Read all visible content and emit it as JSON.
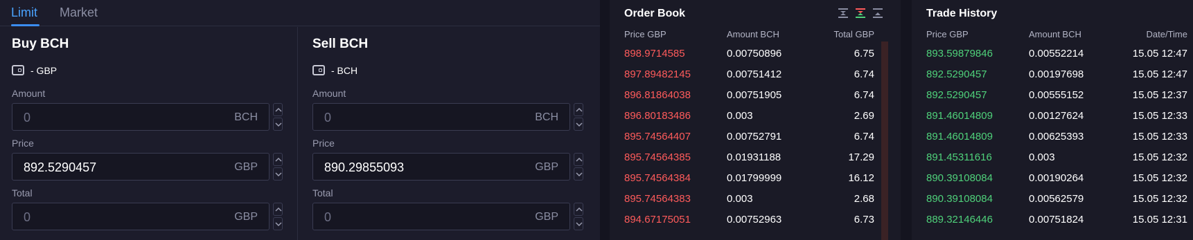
{
  "tabs": [
    {
      "label": "Limit",
      "active": true
    },
    {
      "label": "Market",
      "active": false
    }
  ],
  "buy": {
    "title": "Buy BCH",
    "wallet": "- GBP",
    "amount": {
      "label": "Amount",
      "placeholder": "0",
      "unit": "BCH"
    },
    "price": {
      "label": "Price",
      "value": "892.5290457",
      "unit": "GBP"
    },
    "total": {
      "label": "Total",
      "placeholder": "0",
      "unit": "GBP"
    }
  },
  "sell": {
    "title": "Sell BCH",
    "wallet": "- BCH",
    "amount": {
      "label": "Amount",
      "placeholder": "0",
      "unit": "BCH"
    },
    "price": {
      "label": "Price",
      "value": "890.29855093",
      "unit": "GBP"
    },
    "total": {
      "label": "Total",
      "placeholder": "0",
      "unit": "GBP"
    }
  },
  "order_book": {
    "title": "Order Book",
    "headers": [
      "Price GBP",
      "Amount BCH",
      "Total GBP"
    ],
    "asks": [
      [
        "898.9714585",
        "0.00750896",
        "6.75"
      ],
      [
        "897.89482145",
        "0.00751412",
        "6.74"
      ],
      [
        "896.81864038",
        "0.00751905",
        "6.74"
      ],
      [
        "896.80183486",
        "0.003",
        "2.69"
      ],
      [
        "895.74564407",
        "0.00752791",
        "6.74"
      ],
      [
        "895.74564385",
        "0.01931188",
        "17.29"
      ],
      [
        "895.74564384",
        "0.01799999",
        "16.12"
      ],
      [
        "895.74564383",
        "0.003",
        "2.68"
      ],
      [
        "894.67175051",
        "0.00752963",
        "6.73"
      ]
    ],
    "view_icons": [
      "both-sides-icon",
      "asks-view-icon",
      "bids-view-icon"
    ]
  },
  "trade_history": {
    "title": "Trade History",
    "headers": [
      "Price GBP",
      "Amount BCH",
      "Date/Time"
    ],
    "trades": [
      [
        "893.59879846",
        "0.00552214",
        "15.05 12:47"
      ],
      [
        "892.5290457",
        "0.00197698",
        "15.05 12:47"
      ],
      [
        "892.5290457",
        "0.00555152",
        "15.05 12:37"
      ],
      [
        "891.46014809",
        "0.00127624",
        "15.05 12:33"
      ],
      [
        "891.46014809",
        "0.00625393",
        "15.05 12:33"
      ],
      [
        "891.45311616",
        "0.003",
        "15.05 12:32"
      ],
      [
        "890.39108084",
        "0.00190264",
        "15.05 12:32"
      ],
      [
        "890.39108084",
        "0.00562579",
        "15.05 12:32"
      ],
      [
        "889.32146446",
        "0.00751824",
        "15.05 12:31"
      ]
    ]
  },
  "colors": {
    "ask": "#ff5b5b",
    "trade_buy": "#4fd17a",
    "accent": "#3b8df0"
  }
}
